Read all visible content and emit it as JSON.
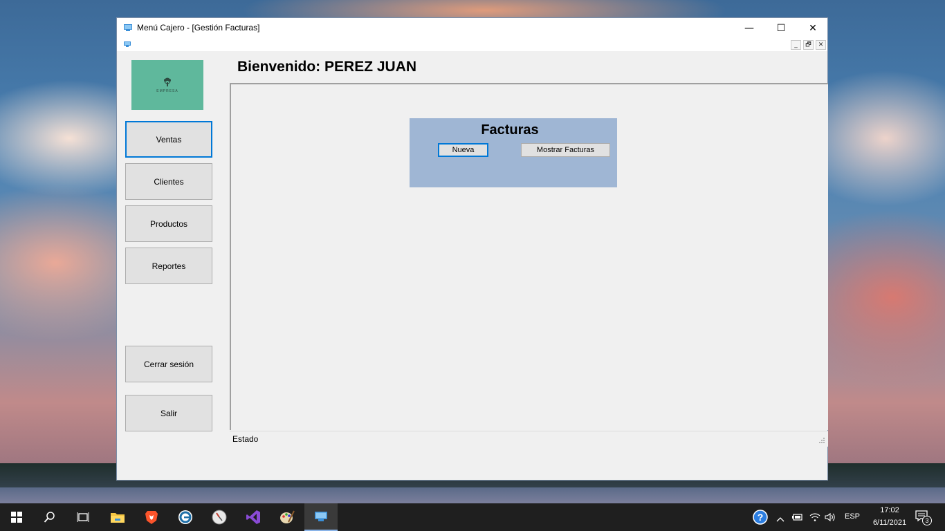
{
  "window": {
    "title": "Menú Cajero - [Gestión Facturas]",
    "controls": {
      "minimize": "—",
      "maximize": "☐",
      "close": "✕"
    },
    "mdi_controls": {
      "minimize": "_",
      "restore": "🗗",
      "close": "✕"
    }
  },
  "logo": {
    "text": "EMPRESA"
  },
  "sidebar": {
    "items": [
      {
        "label": "Ventas"
      },
      {
        "label": "Clientes"
      },
      {
        "label": "Productos"
      },
      {
        "label": "Reportes"
      }
    ],
    "logout_label": "Cerrar sesión",
    "exit_label": "Salir"
  },
  "header": {
    "welcome": "Bienvenido: PEREZ JUAN"
  },
  "facturas": {
    "title": "Facturas",
    "new_label": "Nueva",
    "show_label": "Mostrar Facturas"
  },
  "status": {
    "text": "Estado"
  },
  "taskbar": {
    "apps": [
      "start-icon",
      "search-icon",
      "task-view-icon",
      "file-explorer-icon",
      "brave-browser-icon",
      "edge-icon",
      "clock-app-icon",
      "visual-studio-icon",
      "paint-icon",
      "app-window-icon"
    ],
    "lang": "ESP",
    "time": "17:02",
    "date": "6/11/2021",
    "notifications": "3"
  },
  "colors": {
    "accent": "#0078d7",
    "logo_bg": "#5fb89c",
    "panel_bg": "#9fb6d4",
    "window_bg": "#f0f0f0"
  }
}
